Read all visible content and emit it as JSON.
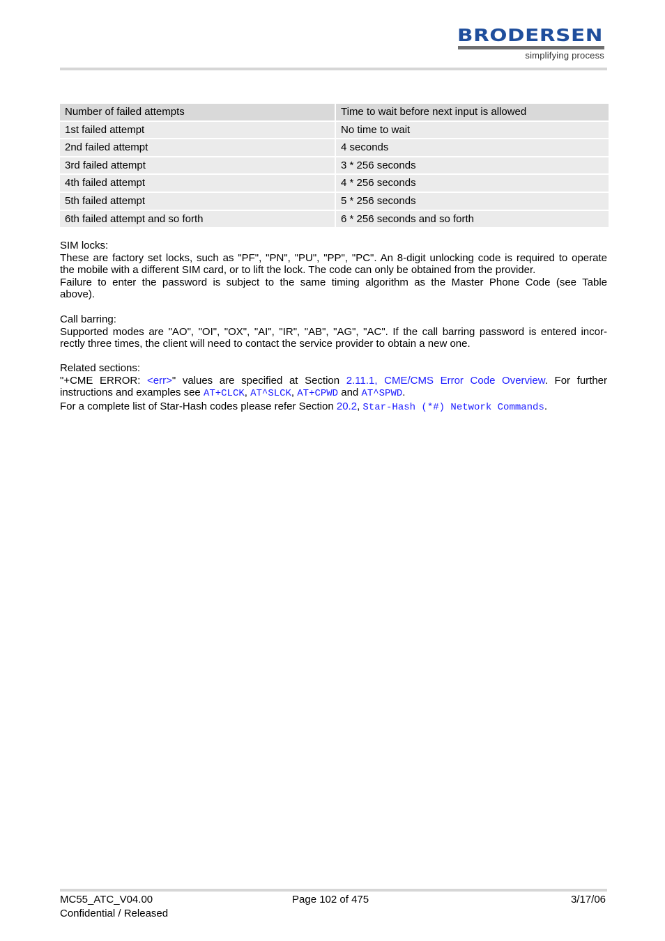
{
  "header": {
    "logo": {
      "brand": "BRODERSEN",
      "tagline": "simplifying process",
      "brand_color": "#1f4e9c"
    }
  },
  "table": {
    "headers": [
      "Number of failed attempts",
      "Time to wait before next input is allowed"
    ],
    "rows": [
      [
        "1st failed attempt",
        "No time to wait"
      ],
      [
        "2nd failed attempt",
        "4 seconds"
      ],
      [
        "3rd failed attempt",
        "3 * 256 seconds"
      ],
      [
        "4th failed attempt",
        "4 * 256 seconds"
      ],
      [
        "5th failed attempt",
        "5 * 256 seconds"
      ],
      [
        "6th failed attempt and so forth",
        "6 * 256 seconds and so forth"
      ]
    ]
  },
  "sim_locks": {
    "title": "SIM locks:",
    "line1": "These are factory set locks, such as \"PF\", \"PN\", \"PU\", \"PP\", \"PC\". An 8-digit unlocking code is required to operate",
    "line2": "the mobile with a different SIM card, or to lift the lock. The code can only be obtained from the provider.",
    "line3": "Failure to enter the password is subject to the same timing algorithm as the Master Phone Code (see Table",
    "line4": "above)."
  },
  "call_barring": {
    "title": "Call barring:",
    "line1": "Supported modes are \"AO\", \"OI\", \"OX\", \"AI\", \"IR\", \"AB\", \"AG\", \"AC\". If the call barring password is entered incor-",
    "line2": "rectly three times, the client will need to contact the service provider to obtain a new one."
  },
  "related": {
    "title": "Related sections:",
    "p1_a": "\"+CME ERROR: ",
    "p1_err": "<err>",
    "p1_b": "\" values are specified at Section ",
    "p1_section": "2.11.1, CME/CMS Error Code Overview",
    "p1_c": ". For further",
    "p2_a": "instructions and examples see ",
    "cmd1": "AT+CLCK",
    "sep1": ", ",
    "cmd2": "AT^SLCK",
    "sep2": ", ",
    "cmd3": "AT+CPWD",
    "and": " and ",
    "cmd4": "AT^SPWD",
    "p2_end": ".",
    "p3_a": "For a complete list of Star-Hash codes please refer Section ",
    "p3_section": "20.2",
    "p3_sep": ", ",
    "p3_title": "Star-Hash (*#) Network Commands",
    "p3_end": ".",
    "link_color": "#1a1aff"
  },
  "footer": {
    "doc_id": "MC55_ATC_V04.00",
    "status": "Confidential / Released",
    "page": "Page 102 of 475",
    "date": "3/17/06"
  }
}
